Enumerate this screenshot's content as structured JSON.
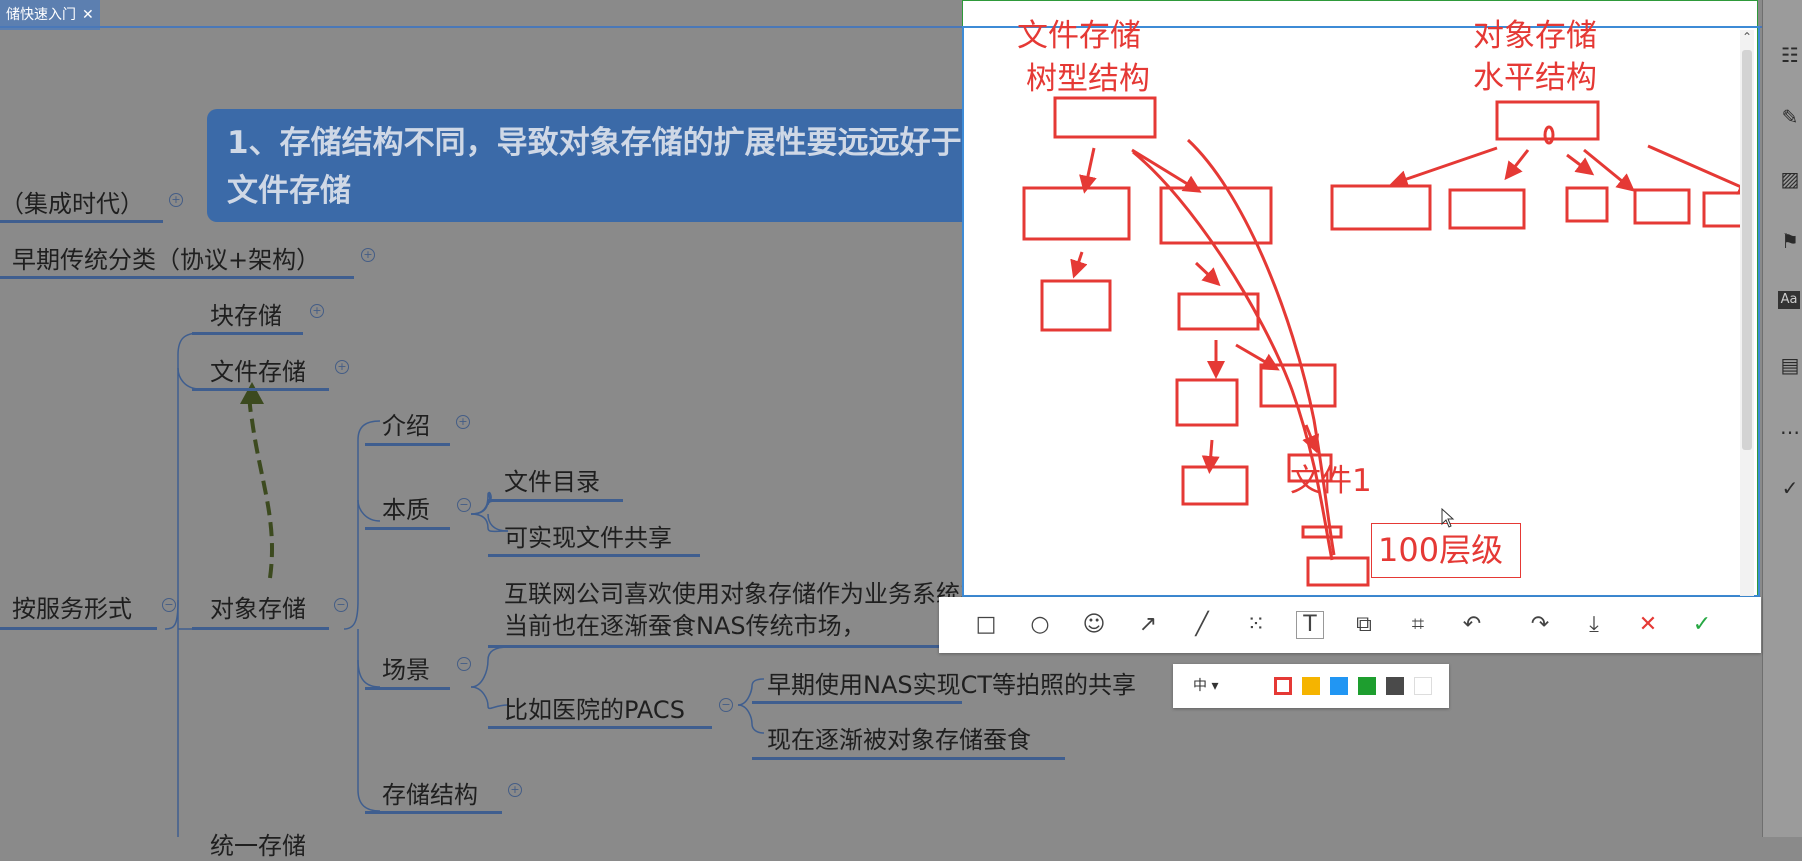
{
  "tab": {
    "label": "储快速入门",
    "close": "✕"
  },
  "callout": {
    "text": "1、存储结构不同，导致对象存储的扩展性要远远好于文件存储"
  },
  "mindmap": {
    "n_integrated": "（集成时代）",
    "n_early": "早期传统分类（协议+架构）",
    "n_block": "块存储",
    "n_file": "文件存储",
    "n_service": "按服务形式",
    "n_object": "对象存储",
    "n_intro": "介绍",
    "n_essence": "本质",
    "n_dir": "文件目录",
    "n_share": "可实现文件共享",
    "n_scene_desc1": "互联网公司喜欢使用对象存储作为业务系统非结构化数据的存储。",
    "n_scene_desc2": "当前也在逐渐蚕食NAS传统市场，",
    "n_scene": "场景",
    "n_pacs": "比如医院的PACS",
    "n_pacs1": "早期使用NAS实现CT等拍照的共享",
    "n_pacs2": "现在逐渐被对象存储蚕食",
    "n_struct": "存储结构",
    "n_bottom": "统一存储"
  },
  "annotation": {
    "file_title1": "文件存储",
    "file_title2": "树型结构",
    "obj_title1": "对象存储",
    "obj_title2": "水平结构",
    "file1": "文件1",
    "levels": "100层级"
  },
  "toolbar": {
    "tools": [
      "rectangle-icon",
      "ellipse-icon",
      "emoji-icon",
      "arrow-icon",
      "pen-icon",
      "mosaic-icon",
      "text-icon",
      "pin-icon",
      "ocr-icon",
      "undo-icon",
      "redo-icon",
      "save-icon",
      "cancel-icon",
      "confirm-icon"
    ],
    "size_label": "中",
    "colors": [
      "#e53935",
      "#f5b400",
      "#2196f3",
      "#1e9e2f",
      "#4a4a4a",
      "#ffffff"
    ]
  }
}
